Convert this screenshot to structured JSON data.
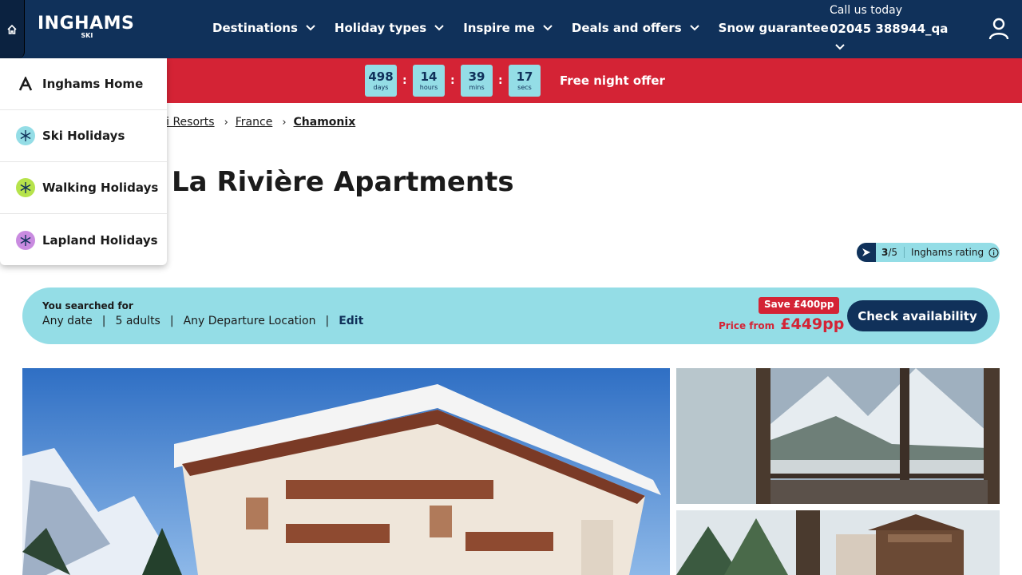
{
  "header": {
    "logo_main": "INGHAMS",
    "logo_sub": "SKI",
    "nav": [
      {
        "label": "Destinations",
        "has_dropdown": true
      },
      {
        "label": "Holiday types",
        "has_dropdown": true
      },
      {
        "label": "Inspire me",
        "has_dropdown": true
      },
      {
        "label": "Deals and offers",
        "has_dropdown": true
      },
      {
        "label": "Snow guarantee",
        "has_dropdown": false
      }
    ],
    "call_label": "Call us today",
    "call_phone": "02045 388944_qa",
    "icons": {
      "home": "home-icon",
      "user": "user-icon",
      "chevron": "chevron-down-icon"
    }
  },
  "promo": {
    "countdown": [
      {
        "value": "498",
        "unit": "days"
      },
      {
        "value": "14",
        "unit": "hours"
      },
      {
        "value": "39",
        "unit": "mins"
      },
      {
        "value": "17",
        "unit": "secs"
      }
    ],
    "separator": ":",
    "text": "Free night offer"
  },
  "breadcrumb": {
    "items": [
      "ki Resorts",
      "France",
      "Chamonix"
    ]
  },
  "page_title": "La Rivière Apartments",
  "rating": {
    "score": "3",
    "out_of": "/5",
    "label": "Inghams rating"
  },
  "search_summary": {
    "title": "You searched for",
    "date": "Any date",
    "guests": "5 adults",
    "departure": "Any Departure Location",
    "edit_label": "Edit",
    "save_badge": "Save £400pp",
    "price_from_label": "Price from",
    "price": "£449pp",
    "check_button": "Check availability"
  },
  "brand_menu": {
    "items": [
      {
        "label": "Inghams Home",
        "icon": "inghams-logo-icon",
        "color": "#1b1b1b"
      },
      {
        "label": "Ski Holidays",
        "icon": "snowflake-icon",
        "color": "#94dde6"
      },
      {
        "label": "Walking Holidays",
        "icon": "snowflake-icon",
        "color": "#b6e34b"
      },
      {
        "label": "Lapland Holidays",
        "icon": "snowflake-icon",
        "color": "#c98be0"
      }
    ]
  },
  "colors": {
    "navy": "#10315a",
    "red": "#d42335",
    "aqua": "#94dde6"
  }
}
